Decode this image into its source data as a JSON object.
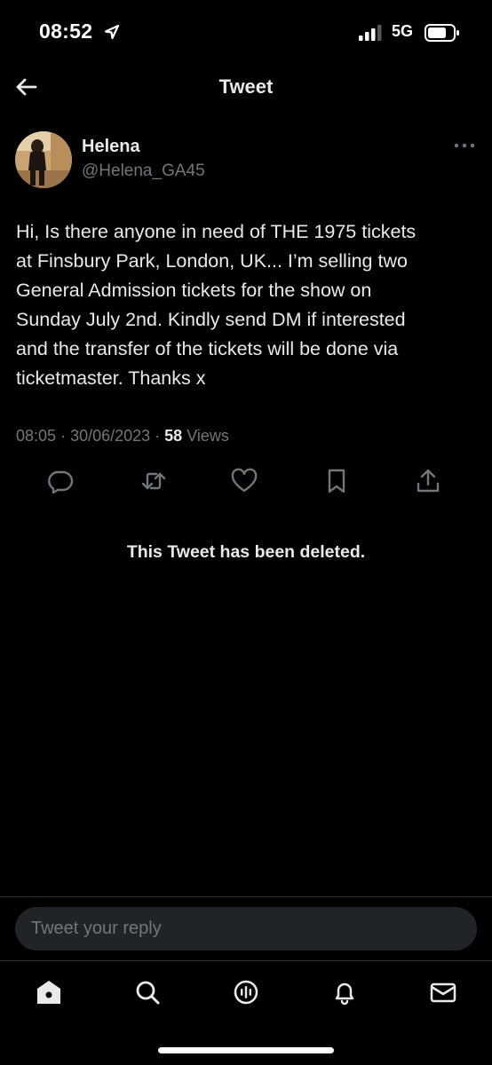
{
  "status_bar": {
    "time": "08:52",
    "network": "5G"
  },
  "header": {
    "title": "Tweet"
  },
  "tweet": {
    "author_name": "Helena",
    "author_handle": "@Helena_GA45",
    "text": "Hi, Is there anyone in need of THE 1975 tickets\nat Finsbury Park, London, UK... I’m selling two\nGeneral Admission tickets for the show on\nSunday July 2nd. Kindly send DM if interested\nand the transfer of the tickets will be done  via\nticketmaster. Thanks x",
    "time": "08:05",
    "date": "30/06/2023",
    "views_count": "58",
    "views_label": "Views"
  },
  "notice": {
    "deleted": "This Tweet has been deleted."
  },
  "reply": {
    "placeholder": "Tweet your reply"
  },
  "icons": {
    "back": "back-arrow-icon",
    "more": "more-icon",
    "reply": "reply-icon",
    "retweet": "retweet-icon",
    "like": "heart-icon",
    "bookmark": "bookmark-icon",
    "share": "share-icon",
    "home": "home-icon",
    "search": "search-icon",
    "spaces": "spaces-icon",
    "notifications": "bell-icon",
    "messages": "mail-icon"
  },
  "colors": {
    "background": "#000000",
    "text": "#e7e9ea",
    "secondary": "#71767b",
    "input": "#202327"
  }
}
